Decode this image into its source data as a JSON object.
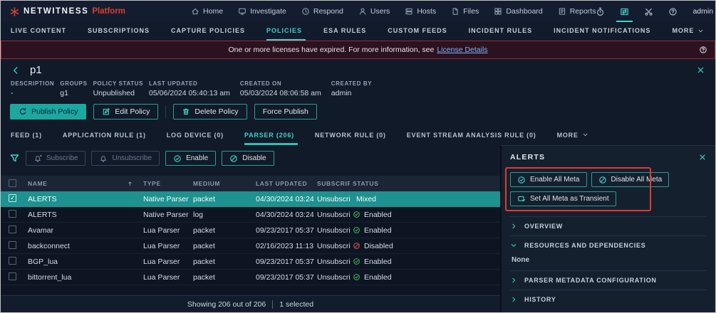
{
  "topnav": {
    "brand_name": "NETWITNESS",
    "brand_suffix": "Platform",
    "items": [
      {
        "name": "nav-home",
        "label": "Home",
        "icon": "home-icon"
      },
      {
        "name": "nav-investigate",
        "label": "Investigate",
        "icon": "investigate-icon"
      },
      {
        "name": "nav-respond",
        "label": "Respond",
        "icon": "respond-icon"
      },
      {
        "name": "nav-users",
        "label": "Users",
        "icon": "users-icon"
      },
      {
        "name": "nav-hosts",
        "label": "Hosts",
        "icon": "hosts-icon"
      },
      {
        "name": "nav-files",
        "label": "Files",
        "icon": "files-icon"
      },
      {
        "name": "nav-dashboard",
        "label": "Dashboard",
        "icon": "dashboard-icon"
      },
      {
        "name": "nav-reports",
        "label": "Reports",
        "icon": "reports-icon"
      }
    ],
    "right_icons": [
      {
        "name": "timer-icon",
        "state": "normal"
      },
      {
        "name": "live-services-icon",
        "state": "active"
      },
      {
        "name": "tools-icon",
        "state": "normal"
      },
      {
        "name": "help-icon",
        "state": "normal"
      }
    ],
    "user_label": "admin"
  },
  "subnav": {
    "items": [
      {
        "name": "subnav-live-content",
        "label": "LIVE CONTENT",
        "state": "normal",
        "chevron": ""
      },
      {
        "name": "subnav-subscriptions",
        "label": "SUBSCRIPTIONS",
        "state": "normal",
        "chevron": ""
      },
      {
        "name": "subnav-capture-policies",
        "label": "CAPTURE POLICIES",
        "state": "normal",
        "chevron": ""
      },
      {
        "name": "subnav-policies",
        "label": "POLICIES",
        "state": "active",
        "chevron": ""
      },
      {
        "name": "subnav-esa-rules",
        "label": "ESA RULES",
        "state": "normal",
        "chevron": ""
      },
      {
        "name": "subnav-custom-feeds",
        "label": "CUSTOM FEEDS",
        "state": "normal",
        "chevron": ""
      },
      {
        "name": "subnav-incident-rules",
        "label": "INCIDENT RULES",
        "state": "normal",
        "chevron": ""
      },
      {
        "name": "subnav-incident-notifications",
        "label": "INCIDENT NOTIFICATIONS",
        "state": "normal",
        "chevron": ""
      },
      {
        "name": "subnav-more",
        "label": "MORE",
        "state": "normal",
        "chevron": "chevron-down-icon"
      }
    ]
  },
  "banner": {
    "message": "One or more licenses have expired. For more information, see",
    "link_label": "License Details"
  },
  "policy": {
    "title": "p1",
    "fields": [
      {
        "label": "DESCRIPTION",
        "value": "-"
      },
      {
        "label": "GROUPS",
        "value": "g1"
      },
      {
        "label": "POLICY STATUS",
        "value": "Unpublished"
      },
      {
        "label": "LAST UPDATED",
        "value": "05/06/2024 05:40:13 am"
      },
      {
        "label": "CREATED ON",
        "value": "05/03/2024 08:06:58 am"
      },
      {
        "label": "CREATED BY",
        "value": "admin"
      }
    ],
    "actions": [
      "Publish Policy",
      "Edit Policy",
      "Delete Policy",
      "Force Publish"
    ]
  },
  "tabs": {
    "items": [
      {
        "name": "tab-feed",
        "label": "FEED (1)",
        "state": "normal",
        "chevron": ""
      },
      {
        "name": "tab-application-rule",
        "label": "APPLICATION RULE (1)",
        "state": "normal",
        "chevron": ""
      },
      {
        "name": "tab-log-device",
        "label": "LOG DEVICE (0)",
        "state": "normal",
        "chevron": ""
      },
      {
        "name": "tab-parser",
        "label": "PARSER (206)",
        "state": "active",
        "chevron": ""
      },
      {
        "name": "tab-network-rule",
        "label": "NETWORK RULE (0)",
        "state": "normal",
        "chevron": ""
      },
      {
        "name": "tab-esa-rule",
        "label": "EVENT STREAM ANALYSIS RULE (0)",
        "state": "normal",
        "chevron": ""
      },
      {
        "name": "tab-more",
        "label": "MORE",
        "state": "normal",
        "chevron": "chevron-down-icon"
      }
    ]
  },
  "toolbar": {
    "buttons": [
      {
        "name": "subscribe-button",
        "label": "Subscribe",
        "icon": "subscribe-icon",
        "state": "disabled"
      },
      {
        "name": "unsubscribe-button",
        "label": "Unsubscribe",
        "icon": "unsubscribe-icon",
        "state": "disabled"
      },
      {
        "name": "enable-button",
        "label": "Enable",
        "icon": "circle-check-icon",
        "state": "normal"
      },
      {
        "name": "disable-button",
        "label": "Disable",
        "icon": "circle-slash-icon",
        "state": "normal"
      }
    ]
  },
  "table": {
    "columns": [
      "NAME",
      "TYPE",
      "MEDIUM",
      "LAST UPDATED",
      "SUBSCRIP...",
      "STATUS"
    ],
    "rows": [
      {
        "name": "ALERTS",
        "type": "Native Parser",
        "medium": "packet",
        "updated": "04/30/2024 03:24:0...",
        "subscribed": "Unsubscri...",
        "status": "Mixed",
        "status_type": "mixed",
        "status_icon": "",
        "state": "selected",
        "check": "checked"
      },
      {
        "name": "ALERTS",
        "type": "Native Parser",
        "medium": "log",
        "updated": "04/30/2024 03:24:0...",
        "subscribed": "Unsubscri...",
        "status": "Enabled",
        "status_type": "enabled",
        "status_icon": "circle-check-icon",
        "state": "normal",
        "check": "unchecked"
      },
      {
        "name": "Avamar",
        "type": "Lua Parser",
        "medium": "packet",
        "updated": "09/23/2017 05:37:0...",
        "subscribed": "Unsubscri...",
        "status": "Enabled",
        "status_type": "enabled",
        "status_icon": "circle-check-icon",
        "state": "normal",
        "check": "unchecked"
      },
      {
        "name": "backconnect",
        "type": "Lua Parser",
        "medium": "packet",
        "updated": "02/16/2023 11:13:0...",
        "subscribed": "Unsubscri...",
        "status": "Disabled",
        "status_type": "disabled",
        "status_icon": "circle-slash-icon",
        "state": "normal",
        "check": "unchecked"
      },
      {
        "name": "BGP_lua",
        "type": "Lua Parser",
        "medium": "packet",
        "updated": "09/23/2017 05:37:0...",
        "subscribed": "Unsubscri...",
        "status": "Enabled",
        "status_type": "enabled",
        "status_icon": "circle-check-icon",
        "state": "normal",
        "check": "unchecked"
      },
      {
        "name": "bittorrent_lua",
        "type": "Lua Parser",
        "medium": "packet",
        "updated": "09/23/2017 05:37:0...",
        "subscribed": "Unsubscri...",
        "status": "Enabled",
        "status_type": "enabled",
        "status_icon": "circle-check-icon",
        "state": "normal",
        "check": "unchecked"
      }
    ],
    "footer_showing": "Showing 206 out of 206",
    "footer_selected": "1 selected"
  },
  "panel": {
    "title": "ALERTS",
    "buttons": [
      {
        "name": "enable-all-meta-button",
        "label": "Enable All Meta",
        "icon": "circle-check-icon"
      },
      {
        "name": "disable-all-meta-button",
        "label": "Disable All Meta",
        "icon": "circle-slash-icon"
      },
      {
        "name": "set-all-meta-transient-button",
        "label": "Set All Meta as Transient",
        "icon": "transient-icon"
      }
    ],
    "sections": [
      {
        "name": "section-overview",
        "label": "OVERVIEW",
        "chevron": "chevron-right-icon",
        "content": ""
      },
      {
        "name": "section-resources-and-dependencies",
        "label": "RESOURCES AND DEPENDENCIES",
        "chevron": "chevron-down-icon",
        "content": "None"
      },
      {
        "name": "section-parser-metadata-configuration",
        "label": "PARSER METADATA CONFIGURATION",
        "chevron": "chevron-right-icon",
        "content": ""
      },
      {
        "name": "section-history",
        "label": "HISTORY",
        "chevron": "chevron-right-icon",
        "content": ""
      }
    ]
  },
  "colors": {
    "accent": "#43d1c6",
    "selected_row": "#1e9290",
    "annotation": "#e23b2e",
    "enabled_status": "#43b654",
    "disabled_status": "#d95050",
    "banner_link": "#7fb0ff",
    "brand_red": "#d8402f"
  }
}
